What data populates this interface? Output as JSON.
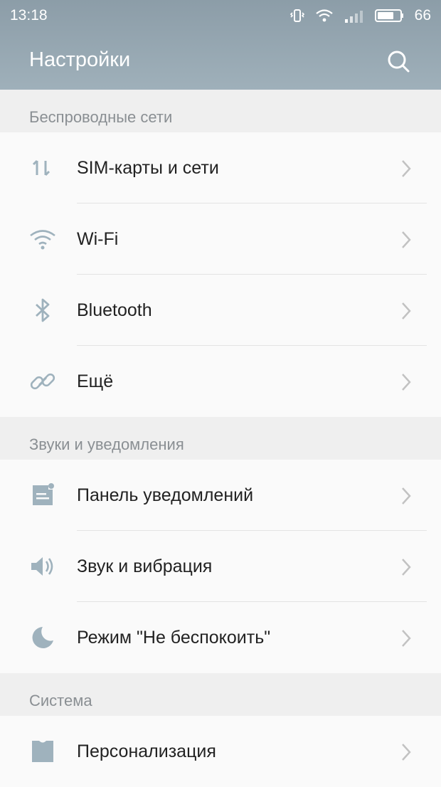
{
  "status_bar": {
    "time": "13:18",
    "battery_level": "66",
    "icons": [
      "vibrate-icon",
      "wifi-icon",
      "signal-icon",
      "battery-icon"
    ]
  },
  "header": {
    "title": "Настройки",
    "search_icon": "search-icon"
  },
  "sections": [
    {
      "title": "Беспроводные сети",
      "items": [
        {
          "label": "SIM-карты и сети",
          "icon": "sim-data-icon"
        },
        {
          "label": "Wi-Fi",
          "icon": "wifi-icon"
        },
        {
          "label": "Bluetooth",
          "icon": "bluetooth-icon"
        },
        {
          "label": "Ещё",
          "icon": "link-icon"
        }
      ]
    },
    {
      "title": "Звуки и уведомления",
      "items": [
        {
          "label": "Панель уведомлений",
          "icon": "notification-panel-icon"
        },
        {
          "label": "Звук и вибрация",
          "icon": "speaker-icon"
        },
        {
          "label": "Режим \"Не беспокоить\"",
          "icon": "moon-icon"
        }
      ]
    },
    {
      "title": "Система",
      "items": [
        {
          "label": "Персонализация",
          "icon": "personalization-icon"
        }
      ]
    }
  ],
  "colors": {
    "header_bg": "#9aabb5",
    "icon": "#9fb2bd",
    "section_text": "#8a8f93",
    "item_text": "#222222",
    "chevron": "#c2c2c2"
  }
}
